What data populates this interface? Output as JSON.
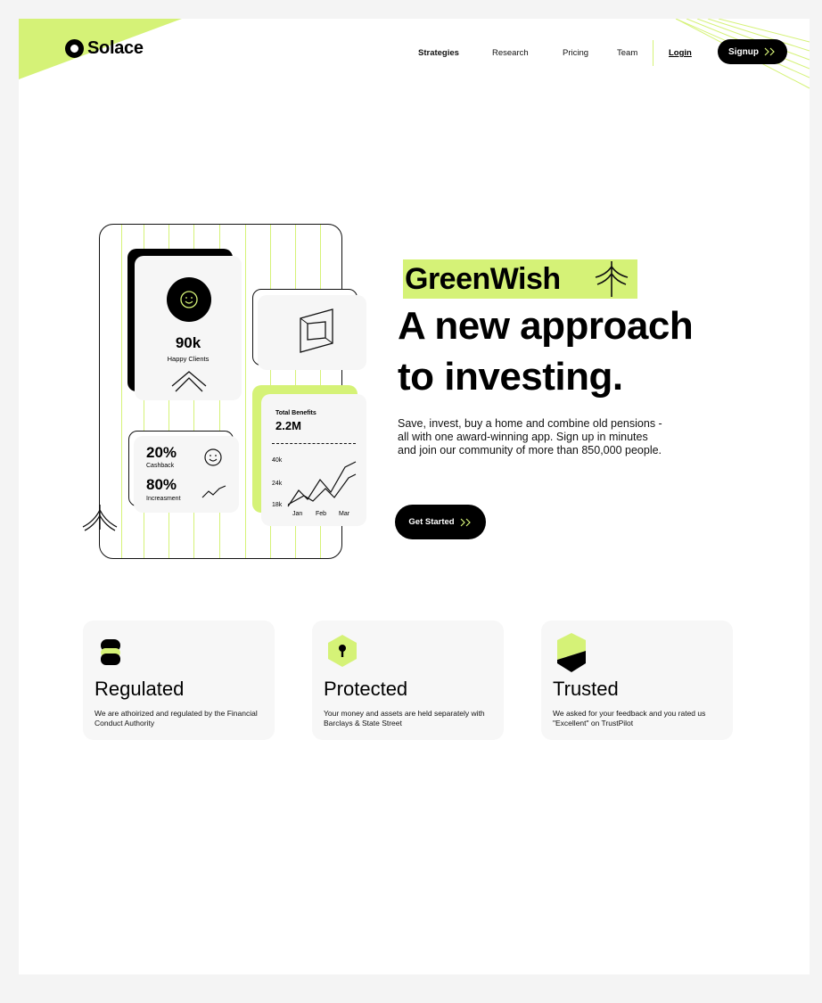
{
  "brand": {
    "name": "Solace",
    "accent": "#d5f277",
    "dark": "#000000"
  },
  "nav": {
    "items": [
      {
        "label": "Strategies",
        "active": true
      },
      {
        "label": "Research",
        "active": false
      },
      {
        "label": "Pricing",
        "active": false
      },
      {
        "label": "Team",
        "active": false
      }
    ],
    "login_label": "Login",
    "signup_label": "Signup"
  },
  "hero": {
    "badge": "GreenWish",
    "headline_line1": "A new approach",
    "headline_line2": "to investing.",
    "description": "Save, invest, buy a home and combine old pensions - all with one award-winning app. Sign up in minutes and join our community of more than 850,000 people.",
    "cta_label": "Get Started"
  },
  "illustration": {
    "clients_value": "90k",
    "clients_label": "Happy Clients",
    "cashback_value": "20%",
    "cashback_label": "Cashback",
    "increase_value": "80%",
    "increase_label": "Increasment",
    "benefits_title": "Total Benefits",
    "benefits_value": "2.2M",
    "y_ticks": [
      "40k",
      "24k",
      "18k"
    ],
    "x_ticks": [
      "Jan",
      "Feb",
      "Mar"
    ]
  },
  "features": [
    {
      "icon": "stack-icon",
      "title": "Regulated",
      "description": "We are athoirized and regulated by the Financial Conduct Authority"
    },
    {
      "icon": "shield-lock-icon",
      "title": "Protected",
      "description": "Your money and assets are held separately with Barclays & State Street"
    },
    {
      "icon": "hexagon-icon",
      "title": "Trusted",
      "description": "We asked for your feedback and you rated us \"Excellent\" on TrustPilot"
    }
  ]
}
